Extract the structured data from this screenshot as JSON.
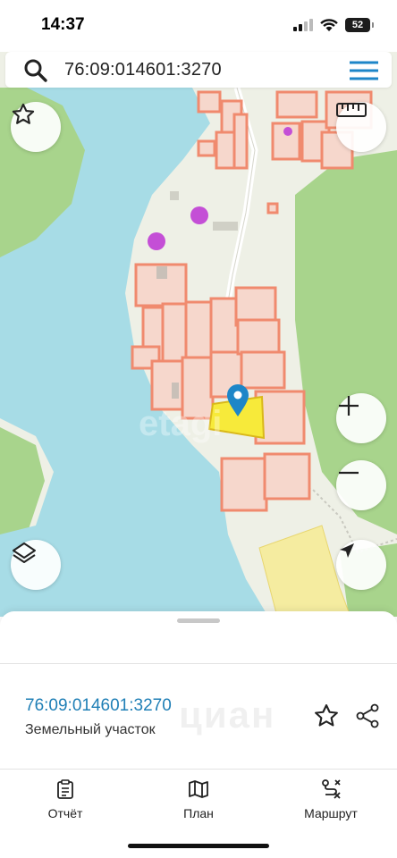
{
  "status_bar": {
    "time": "14:37",
    "battery_level": "52",
    "icons": [
      "cellular-signal-icon",
      "wifi-icon",
      "battery-icon"
    ]
  },
  "search": {
    "query": "76:09:014601:3270",
    "icon": "search-icon",
    "menu_icon": "hamburger-menu-icon"
  },
  "map": {
    "watermark": "etagi",
    "controls": [
      "favorite-star-icon",
      "ruler-icon",
      "zoom-in-icon",
      "zoom-out-icon",
      "layers-icon",
      "locate-arrow-icon"
    ],
    "colors": {
      "water": "#a7dce6",
      "forest": "#a8d48c",
      "land": "#eef0e6",
      "parcel_outline": "#f08a6e",
      "selected_parcel": "#f7ea3a",
      "marker": "#1d86c8"
    }
  },
  "sheet": {
    "parcel_number": "76:09:014601:3270",
    "parcel_type": "Земельный участок",
    "watermark": "циан"
  },
  "tabs": [
    {
      "label": "Отчёт",
      "icon": "report-icon"
    },
    {
      "label": "План",
      "icon": "map-plan-icon"
    },
    {
      "label": "Маршрут",
      "icon": "route-icon"
    }
  ]
}
